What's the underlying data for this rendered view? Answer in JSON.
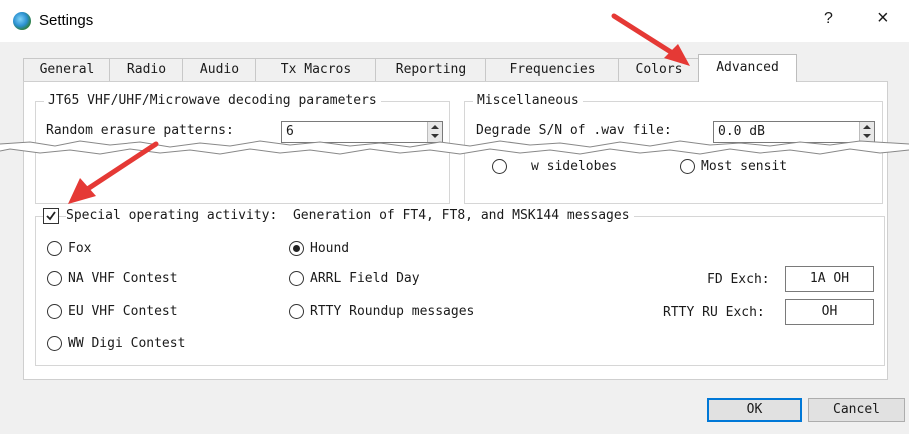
{
  "window": {
    "title": "Settings",
    "help_label": "?",
    "close_label": "×"
  },
  "tabs": [
    {
      "label": "General"
    },
    {
      "label": "Radio"
    },
    {
      "label": "Audio"
    },
    {
      "label": "Tx Macros"
    },
    {
      "label": "Reporting"
    },
    {
      "label": "Frequencies"
    },
    {
      "label": "Colors"
    },
    {
      "label": "Advanced",
      "active": true
    }
  ],
  "jt65": {
    "title": "JT65 VHF/UHF/Microwave decoding parameters",
    "erasure_label": "Random erasure patterns:",
    "erasure_value": "6",
    "partial_text": "w sidelobes"
  },
  "misc": {
    "title": "Miscellaneous",
    "degrade_label": "Degrade S/N of .wav file:",
    "degrade_value": "0.0 dB",
    "partial_text": "Most sensit"
  },
  "special": {
    "checkbox_label": "Special operating activity:  Generation of FT4, FT8, and MSK144 messages",
    "checked": true,
    "options": [
      {
        "label": "Fox",
        "selected": false
      },
      {
        "label": "NA VHF Contest",
        "selected": false
      },
      {
        "label": "EU VHF Contest",
        "selected": false
      },
      {
        "label": "WW Digi Contest",
        "selected": false
      },
      {
        "label": "Hound",
        "selected": true
      },
      {
        "label": "ARRL Field Day",
        "selected": false
      },
      {
        "label": "RTTY Roundup messages",
        "selected": false
      }
    ],
    "fd_exch_label": "FD Exch:",
    "fd_exch_value": "1A OH",
    "rtty_exch_label": "RTTY RU Exch:",
    "rtty_exch_value": "OH"
  },
  "buttons": {
    "ok": "OK",
    "cancel": "Cancel"
  },
  "colors": {
    "accent": "#0078d7",
    "annotation_arrow": "#e53935"
  }
}
